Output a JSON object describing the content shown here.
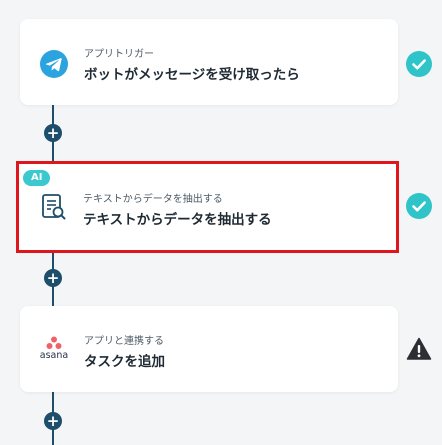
{
  "steps": [
    {
      "subtitle": "アプリトリガー",
      "title": "ボットがメッセージを受け取ったら",
      "icon": "telegram-icon",
      "status": "check-icon"
    },
    {
      "badge": "AI",
      "subtitle": "テキストからデータを抽出する",
      "title": "テキストからデータを抽出する",
      "icon": "document-search-icon",
      "status": "check-icon"
    },
    {
      "subtitle": "アプリと連携する",
      "title": "タスクを追加",
      "icon": "asana-icon",
      "icon_label": "asana",
      "status": "warning-icon"
    }
  ],
  "add_step_symbol": "+",
  "colors": {
    "connector": "#1d4e6a",
    "check": "#2ec4c8",
    "ai_badge": "#3bc8cf",
    "highlight": "#e0161d"
  }
}
